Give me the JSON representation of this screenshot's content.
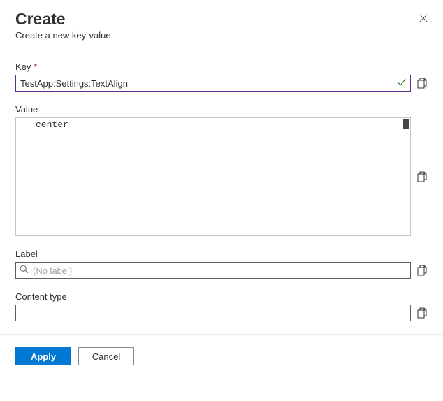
{
  "header": {
    "title": "Create",
    "subtitle": "Create a new key-value."
  },
  "fields": {
    "key": {
      "label": "Key",
      "required_mark": "*",
      "value": "TestApp:Settings:TextAlign"
    },
    "value": {
      "label": "Value",
      "value": "center"
    },
    "label": {
      "label": "Label",
      "placeholder": "(No label)",
      "value": ""
    },
    "content_type": {
      "label": "Content type",
      "value": ""
    }
  },
  "footer": {
    "apply": "Apply",
    "cancel": "Cancel"
  }
}
